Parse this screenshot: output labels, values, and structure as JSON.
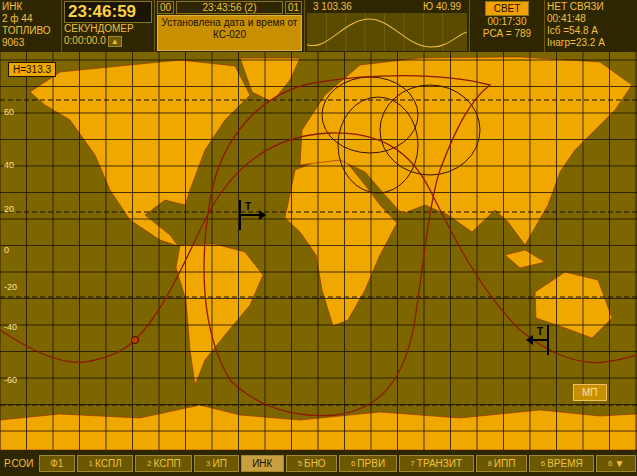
{
  "header": {
    "mode": "ИНК",
    "orbit": "2 ф 44",
    "clock": "23:46:59",
    "fuel_label": "ТОПЛИВО",
    "fuel": "9063",
    "stopwatch_label": "СЕКУНДОМЕР",
    "stopwatch": "0:00:00.0",
    "stopwatch_button": "▲",
    "prev_index": "00",
    "event_time": "23:43:56 (2)",
    "next_index": "01",
    "message": "Установлена дата и время от КС-020",
    "longitude": "3 103.36",
    "latitude": "Ю 40.99",
    "light": {
      "label": "СВЕТ",
      "active": true,
      "time": "00:17:30"
    },
    "pca": "РСА = 789",
    "comm": {
      "label": "НЕТ СВЯЗИ",
      "time": "00:41:48"
    },
    "battery_current": "Iсб =54.8 А",
    "load_current": "Iнагр=23.2 А"
  },
  "map": {
    "altitude": "H=313.3",
    "lat_labels": [
      "60",
      "40",
      "20",
      "0",
      "-20",
      "-40",
      "-60"
    ],
    "markers": [
      {
        "label": "Т",
        "direction": "right"
      },
      {
        "label": "Т",
        "direction": "left"
      }
    ],
    "map_button": "МП"
  },
  "softkeys": {
    "label": "Р.СОИ",
    "keys": [
      {
        "num": "",
        "label": "Ф1",
        "selected": false
      },
      {
        "num": "1",
        "label": "КСПЛ",
        "selected": false
      },
      {
        "num": "2",
        "label": "КСПП",
        "selected": false
      },
      {
        "num": "3",
        "label": "ИП",
        "selected": false
      },
      {
        "num": "",
        "label": "ИНК",
        "selected": true
      },
      {
        "num": "5",
        "label": "БНО",
        "selected": false
      },
      {
        "num": "6",
        "label": "ПРВИ",
        "selected": false
      },
      {
        "num": "7",
        "label": "ТРАНЗИТ",
        "selected": false
      },
      {
        "num": "8",
        "label": "ИПП",
        "selected": false
      },
      {
        "num": "6",
        "label": "ВРЕМЯ",
        "selected": false
      },
      {
        "num": "6",
        "label": "▼",
        "selected": false
      }
    ]
  }
}
